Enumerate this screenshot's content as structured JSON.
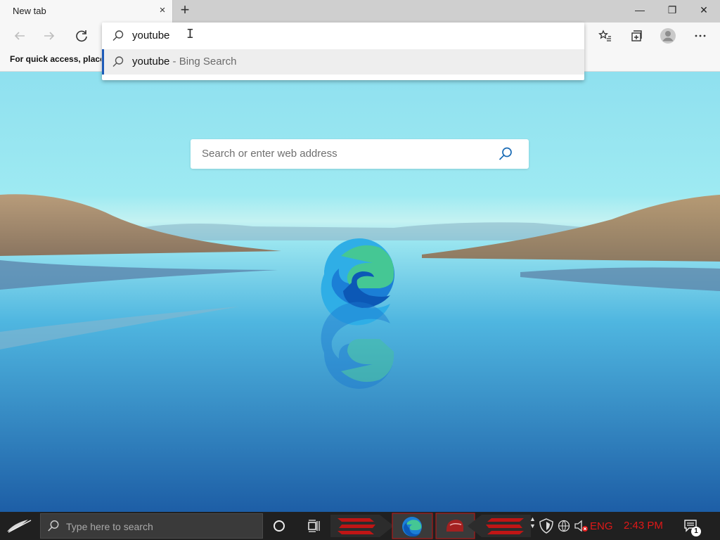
{
  "browser": {
    "tab_title": "New tab",
    "tab_close": "×",
    "new_tab": "+",
    "window_buttons": {
      "minimize": "—",
      "restore": "❐",
      "close": "✕"
    },
    "favorites_bar_text": "For quick access, place y",
    "address_query": "youtube",
    "suggestion": {
      "query": "youtube",
      "suffix": " - Bing Search"
    }
  },
  "new_tab_page": {
    "search_placeholder": "Search or enter web address"
  },
  "taskbar": {
    "search_placeholder": "Type here to search",
    "language": "ENG",
    "time": "2:43 PM",
    "notification_count": "1"
  },
  "colors": {
    "accent": "#1e5bb8",
    "tray_red": "#e01818"
  }
}
